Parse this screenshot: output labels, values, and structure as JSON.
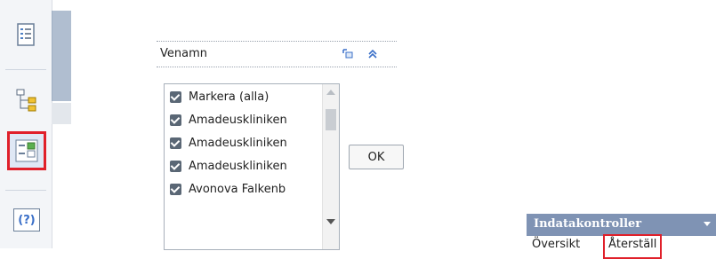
{
  "filter": {
    "title": "Venamn",
    "items": [
      {
        "label": "Markera (alla)",
        "checked": true
      },
      {
        "label": "Amadeuskliniken",
        "checked": true
      },
      {
        "label": "Amadeuskliniken",
        "checked": true
      },
      {
        "label": "Amadeuskliniken",
        "checked": true
      },
      {
        "label": "Avonova Falkenb",
        "checked": true
      }
    ],
    "ok_label": "OK"
  },
  "panel": {
    "title": "Indatakontroller",
    "tabs": [
      "Översikt",
      "Återställ"
    ]
  },
  "colors": {
    "highlight": "#e0202a",
    "panel_header": "#7f93b4",
    "checkbox": "#5a6775"
  },
  "toolbar": {
    "icons": [
      "document-list-icon",
      "tree-hierarchy-icon",
      "filter-list-icon",
      "help-icon"
    ],
    "selected": "filter-list-icon",
    "help_label": "(?)"
  }
}
